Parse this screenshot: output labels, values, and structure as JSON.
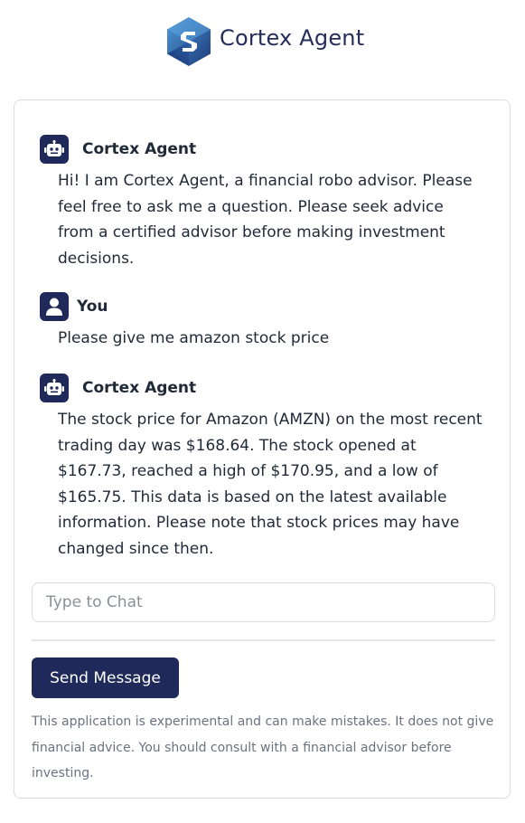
{
  "header": {
    "brand_name": "Cortex Agent",
    "logo_icon": "cortex-logo-icon"
  },
  "messages": [
    {
      "sender": "Cortex Agent",
      "icon": "robot-icon",
      "text": "Hi! I am Cortex Agent, a financial robo advisor. Please feel free to ask me a question. Please seek advice from a certified advisor before making investment decisions."
    },
    {
      "sender": "You",
      "icon": "user-icon",
      "text": "Please give me amazon stock price"
    },
    {
      "sender": "Cortex Agent",
      "icon": "robot-icon",
      "text": "The stock price for Amazon (AMZN) on the most recent trading day was $168.64. The stock opened at $167.73, reached a high of $170.95, and a low of $165.75. This data is based on the latest available information. Please note that stock prices may have changed since then."
    }
  ],
  "chat": {
    "placeholder": "Type to Chat",
    "value": ""
  },
  "send_button": {
    "label": "Send Message"
  },
  "disclaimer": "This application is experimental and can make mistakes. It does not give financial advice. You should consult with a financial advisor before investing.",
  "colors": {
    "primary": "#1f2a5a",
    "logo_light": "#3b82c4",
    "logo_dark": "#1c3a7a",
    "border": "#d9dce1",
    "muted_text": "#6b7280"
  }
}
